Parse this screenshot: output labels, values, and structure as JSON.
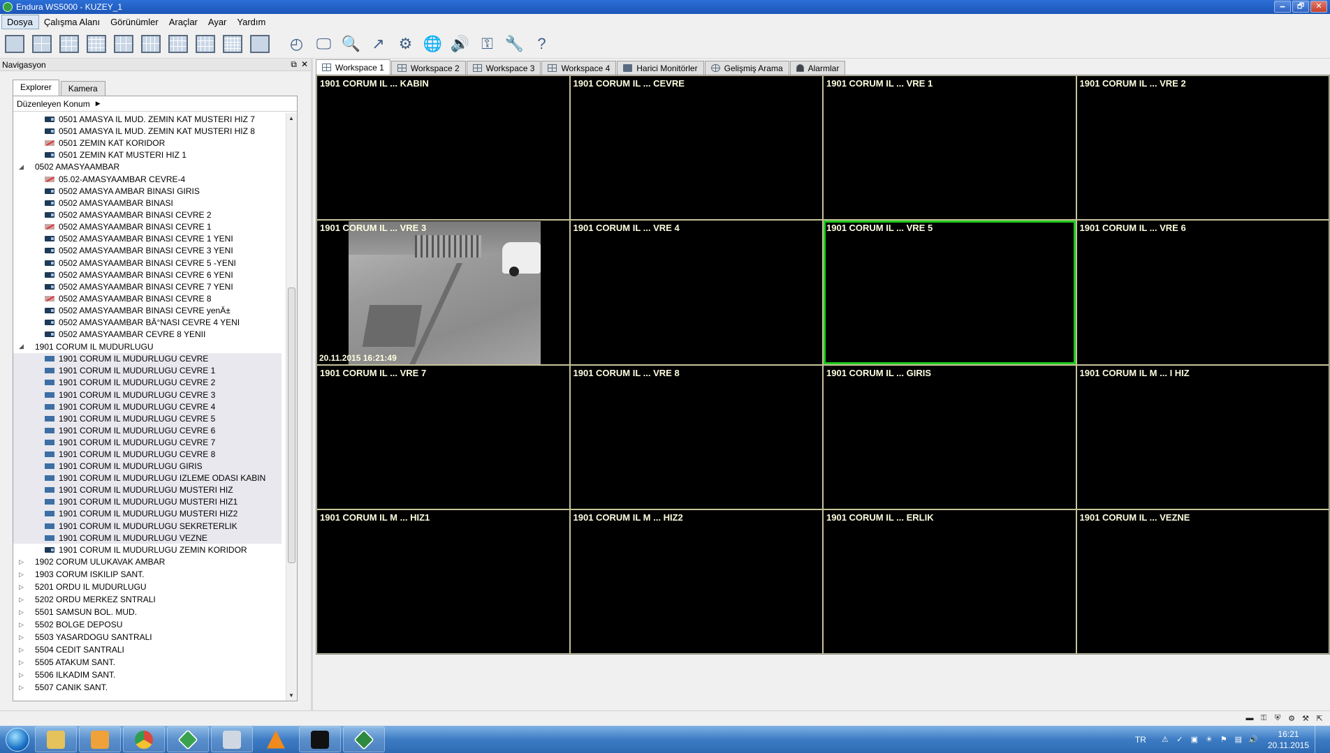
{
  "window": {
    "title": "Endura WS5000 - KUZEY_1",
    "controls": [
      "🗕",
      "🗗",
      "✕"
    ]
  },
  "menu": [
    {
      "label": "Dosya",
      "active": true
    },
    {
      "label": "Çalışma Alanı"
    },
    {
      "label": "Görünümler"
    },
    {
      "label": "Araçlar"
    },
    {
      "label": "Ayar"
    },
    {
      "label": "Yardım"
    }
  ],
  "toolbar": {
    "layouts": [
      {
        "name": "layout-1x1-icon",
        "cols": 1,
        "cells": 1
      },
      {
        "name": "layout-2x2-icon",
        "cols": 2,
        "cells": 4
      },
      {
        "name": "layout-3x3-icon",
        "cols": 3,
        "cells": 9
      },
      {
        "name": "layout-4x4-icon",
        "cols": 4,
        "cells": 16
      },
      {
        "name": "layout-1plus5-icon",
        "cols": 3,
        "cells": 6
      },
      {
        "name": "layout-1plus7-icon",
        "cols": 4,
        "cells": 8
      },
      {
        "name": "layout-1plus12-icon",
        "cols": 4,
        "cells": 12
      },
      {
        "name": "layout-2plus8-icon",
        "cols": 4,
        "cells": 12
      },
      {
        "name": "layout-5x5-icon",
        "cols": 5,
        "cells": 25
      },
      {
        "name": "fullscreen-icon",
        "cols": 1,
        "cells": 1
      }
    ],
    "tools": [
      {
        "name": "playback-icon",
        "glyph": "◴"
      },
      {
        "name": "monitor-icon",
        "glyph": "🖵"
      },
      {
        "name": "search-icon",
        "glyph": "🔍"
      },
      {
        "name": "export-icon",
        "glyph": "↗"
      },
      {
        "name": "camera-settings-icon",
        "glyph": "⚙"
      },
      {
        "name": "globe-icon",
        "glyph": "🌐"
      },
      {
        "name": "audio-icon",
        "glyph": "🔊"
      },
      {
        "name": "key-icon",
        "glyph": "⚿"
      },
      {
        "name": "wrench-icon",
        "glyph": "🔧"
      },
      {
        "name": "help-icon",
        "glyph": "?"
      }
    ]
  },
  "nav": {
    "title": "Navigasyon",
    "header_buttons": [
      "⧉",
      "✕"
    ],
    "tabs": [
      {
        "label": "Explorer",
        "active": true
      },
      {
        "label": "Kamera"
      }
    ],
    "konum_label": "Düzenleyen Konum",
    "tree": [
      {
        "type": "cam",
        "status": "ok",
        "label": "0501 AMASYA IL MUD. ZEMIN KAT MUSTERI HIZ 7"
      },
      {
        "type": "cam",
        "status": "ok",
        "label": "0501 AMASYA IL MUD. ZEMIN KAT MUSTERI HIZ 8"
      },
      {
        "type": "cam",
        "status": "bad",
        "label": "0501 ZEMIN KAT KORIDOR"
      },
      {
        "type": "cam",
        "status": "ok",
        "label": "0501 ZEMIN KAT MUSTERI HIZ 1"
      },
      {
        "type": "group",
        "expanded": true,
        "label": "0502 AMASYAAMBAR"
      },
      {
        "type": "cam",
        "status": "bad",
        "label": "05.02-AMASYAAMBAR CEVRE-4"
      },
      {
        "type": "cam",
        "status": "ok",
        "label": "0502 AMASYA AMBAR BINASI GIRIS"
      },
      {
        "type": "cam",
        "status": "ok",
        "label": "0502 AMASYAAMBAR BINASI"
      },
      {
        "type": "cam",
        "status": "ok",
        "label": "0502 AMASYAAMBAR BINASI  CEVRE 2"
      },
      {
        "type": "cam",
        "status": "bad",
        "label": "0502 AMASYAAMBAR BINASI CEVRE 1"
      },
      {
        "type": "cam",
        "status": "ok",
        "label": "0502 AMASYAAMBAR BINASI CEVRE 1 YENI"
      },
      {
        "type": "cam",
        "status": "ok",
        "label": "0502 AMASYAAMBAR BINASI CEVRE 3 YENI"
      },
      {
        "type": "cam",
        "status": "ok",
        "label": "0502 AMASYAAMBAR BINASI CEVRE 5 -YENI"
      },
      {
        "type": "cam",
        "status": "ok",
        "label": "0502 AMASYAAMBAR BINASI CEVRE 6 YENI"
      },
      {
        "type": "cam",
        "status": "ok",
        "label": "0502 AMASYAAMBAR BINASI CEVRE 7 YENI"
      },
      {
        "type": "cam",
        "status": "bad",
        "label": "0502 AMASYAAMBAR BINASI CEVRE 8"
      },
      {
        "type": "cam",
        "status": "ok",
        "label": "0502 AMASYAAMBAR BINASI CEVRE yenÄ±"
      },
      {
        "type": "cam",
        "status": "ok",
        "label": "0502 AMASYAAMBAR BÄ°NASI CEVRE 4 YENI"
      },
      {
        "type": "cam",
        "status": "ok",
        "label": "0502 AMASYAAMBAR CEVRE 8 YENII"
      },
      {
        "type": "group",
        "expanded": true,
        "label": "1901 CORUM IL MUDURLUGU"
      },
      {
        "type": "cam",
        "status": "blue",
        "sel": true,
        "label": "1901 CORUM IL MUDURLUGU CEVRE"
      },
      {
        "type": "cam",
        "status": "blue",
        "sel": true,
        "label": "1901 CORUM IL MUDURLUGU CEVRE 1"
      },
      {
        "type": "cam",
        "status": "blue",
        "sel": true,
        "label": "1901 CORUM IL MUDURLUGU CEVRE 2"
      },
      {
        "type": "cam",
        "status": "blue",
        "sel": true,
        "label": "1901 CORUM IL MUDURLUGU CEVRE 3"
      },
      {
        "type": "cam",
        "status": "blue",
        "sel": true,
        "label": "1901 CORUM IL MUDURLUGU CEVRE 4"
      },
      {
        "type": "cam",
        "status": "blue",
        "sel": true,
        "label": "1901 CORUM IL MUDURLUGU CEVRE 5"
      },
      {
        "type": "cam",
        "status": "blue",
        "sel": true,
        "label": "1901 CORUM IL MUDURLUGU CEVRE 6"
      },
      {
        "type": "cam",
        "status": "blue",
        "sel": true,
        "label": "1901 CORUM IL MUDURLUGU CEVRE 7"
      },
      {
        "type": "cam",
        "status": "blue",
        "sel": true,
        "label": "1901 CORUM IL MUDURLUGU CEVRE 8"
      },
      {
        "type": "cam",
        "status": "blue",
        "sel": true,
        "label": "1901 CORUM IL MUDURLUGU GIRIS"
      },
      {
        "type": "cam",
        "status": "blue",
        "sel": true,
        "label": "1901 CORUM IL MUDURLUGU IZLEME ODASI KABIN"
      },
      {
        "type": "cam",
        "status": "blue",
        "sel": true,
        "label": "1901 CORUM IL MUDURLUGU MUSTERI HIZ"
      },
      {
        "type": "cam",
        "status": "blue",
        "sel": true,
        "label": "1901 CORUM IL MUDURLUGU MUSTERI HIZ1"
      },
      {
        "type": "cam",
        "status": "blue",
        "sel": true,
        "label": "1901 CORUM IL MUDURLUGU MUSTERI HIZ2"
      },
      {
        "type": "cam",
        "status": "blue",
        "sel": true,
        "label": "1901 CORUM IL MUDURLUGU SEKRETERLIK"
      },
      {
        "type": "cam",
        "status": "blue",
        "sel": true,
        "label": "1901 CORUM IL MUDURLUGU VEZNE"
      },
      {
        "type": "cam",
        "status": "ok",
        "label": "1901 CORUM IL MUDURLUGU ZEMIN KORIDOR"
      },
      {
        "type": "group",
        "expanded": false,
        "label": "1902 CORUM ULUKAVAK AMBAR"
      },
      {
        "type": "group",
        "expanded": false,
        "label": "1903 CORUM ISKILIP SANT."
      },
      {
        "type": "group",
        "expanded": false,
        "label": "5201 ORDU IL MUDURLUGU"
      },
      {
        "type": "group",
        "expanded": false,
        "label": "5202 ORDU MERKEZ SNTRALI"
      },
      {
        "type": "group",
        "expanded": false,
        "label": "5501 SAMSUN BOL. MUD."
      },
      {
        "type": "group",
        "expanded": false,
        "label": "5502 BOLGE DEPOSU"
      },
      {
        "type": "group",
        "expanded": false,
        "label": "5503 YASARDOGU SANTRALI"
      },
      {
        "type": "group",
        "expanded": false,
        "label": "5504 CEDIT SANTRALI"
      },
      {
        "type": "group",
        "expanded": false,
        "label": "5505 ATAKUM SANT."
      },
      {
        "type": "group",
        "expanded": false,
        "label": "5506 ILKADIM SANT."
      },
      {
        "type": "group",
        "expanded": false,
        "label": "5507 CANIK SANT."
      }
    ]
  },
  "workspace_tabs": [
    {
      "label": "Workspace 1",
      "icon": "workspace-grid-icon",
      "active": true
    },
    {
      "label": "Workspace 2",
      "icon": "workspace-grid-icon"
    },
    {
      "label": "Workspace 3",
      "icon": "workspace-grid-icon"
    },
    {
      "label": "Workspace 4",
      "icon": "workspace-grid-icon"
    },
    {
      "label": "Harici Monitörler",
      "icon": "monitor-icon"
    },
    {
      "label": "Gelişmiş Arama",
      "icon": "advanced-search-icon"
    },
    {
      "label": "Alarmlar",
      "icon": "bell-icon"
    }
  ],
  "cells": [
    {
      "label": "1901 CORUM IL  ... KABIN"
    },
    {
      "label": "1901 CORUM IL  ... CEVRE"
    },
    {
      "label": "1901 CORUM IL  ... VRE 1"
    },
    {
      "label": "1901 CORUM IL  ... VRE 2"
    },
    {
      "label": "1901 CORUM IL  ... VRE 3",
      "live": true,
      "timestamp": "20.11.2015 16:21:49"
    },
    {
      "label": "1901 CORUM IL  ... VRE 4"
    },
    {
      "label": "1901 CORUM IL  ... VRE 5",
      "selected": true
    },
    {
      "label": "1901 CORUM IL  ... VRE 6"
    },
    {
      "label": "1901 CORUM IL  ... VRE 7"
    },
    {
      "label": "1901 CORUM IL  ... VRE 8"
    },
    {
      "label": "1901 CORUM IL  ... GIRIS"
    },
    {
      "label": "1901 CORUM IL M ... I HIZ"
    },
    {
      "label": "1901 CORUM IL M ...  HIZ1"
    },
    {
      "label": "1901 CORUM IL M ...  HIZ2"
    },
    {
      "label": "1901 CORUM IL  ... ERLIK"
    },
    {
      "label": "1901 CORUM IL  ... VEZNE"
    }
  ],
  "statusbar_icons": [
    {
      "name": "connection-icon",
      "glyph": "▬"
    },
    {
      "name": "key-icon",
      "glyph": "⚿"
    },
    {
      "name": "shield-icon",
      "glyph": "⛨"
    },
    {
      "name": "settings-icon",
      "glyph": "⚙"
    },
    {
      "name": "tools-icon",
      "glyph": "⚒"
    },
    {
      "name": "popout-icon",
      "glyph": "⇱"
    }
  ],
  "taskbar": {
    "apps": [
      {
        "name": "explorer-folder-icon",
        "color": "#e6c25c"
      },
      {
        "name": "media-player-icon",
        "color": "#f0a23a"
      },
      {
        "name": "chrome-icon",
        "color": "#d94a3a"
      },
      {
        "name": "endura-app-icon",
        "color": "#3aa24e"
      },
      {
        "name": "document-icon",
        "color": "#cfd8e2"
      },
      {
        "name": "vlc-icon",
        "color": "#f08a1c",
        "plain": true
      },
      {
        "name": "cmd-icon",
        "color": "#111111"
      },
      {
        "name": "endura-workstation-icon",
        "color": "#2e8a3e"
      }
    ],
    "lang": "TR",
    "tray_icons": [
      "⚠",
      "✓",
      "▣",
      "☀",
      "⚑",
      "▤",
      "🔊"
    ],
    "time": "16:21",
    "date": "20.11.2015"
  }
}
